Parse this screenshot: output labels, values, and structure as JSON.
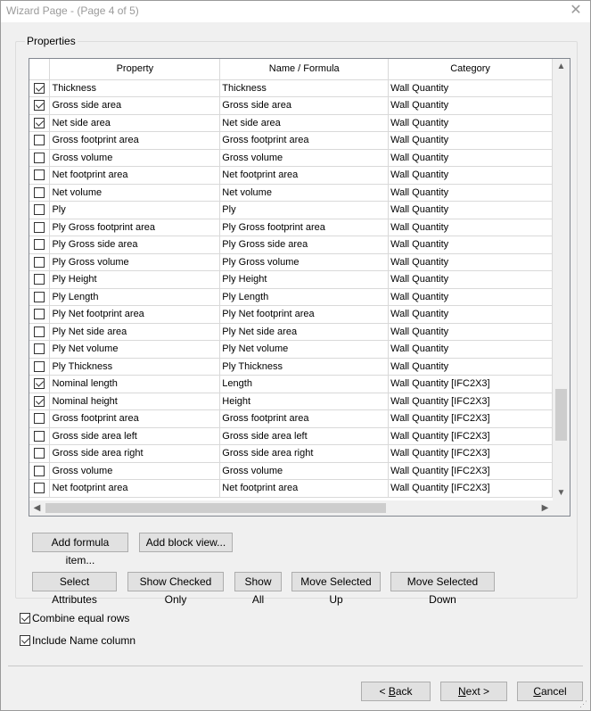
{
  "window": {
    "title": "Wizard Page - (Page 4 of 5)",
    "close_glyph": "✕"
  },
  "group": {
    "legend": "Properties"
  },
  "grid": {
    "columns": [
      "",
      "Property",
      "Name / Formula",
      "Category"
    ],
    "rows": [
      {
        "checked": true,
        "property": "Thickness",
        "name": "Thickness",
        "category": "Wall Quantity"
      },
      {
        "checked": true,
        "property": "Gross side area",
        "name": "Gross side area",
        "category": "Wall Quantity"
      },
      {
        "checked": true,
        "property": "Net side area",
        "name": "Net side area",
        "category": "Wall Quantity"
      },
      {
        "checked": false,
        "property": "Gross footprint area",
        "name": "Gross footprint area",
        "category": "Wall Quantity"
      },
      {
        "checked": false,
        "property": "Gross volume",
        "name": "Gross volume",
        "category": "Wall Quantity"
      },
      {
        "checked": false,
        "property": "Net footprint area",
        "name": "Net footprint area",
        "category": "Wall Quantity"
      },
      {
        "checked": false,
        "property": "Net volume",
        "name": "Net volume",
        "category": "Wall Quantity"
      },
      {
        "checked": false,
        "property": "Ply",
        "name": "Ply",
        "category": "Wall Quantity"
      },
      {
        "checked": false,
        "property": "Ply Gross footprint area",
        "name": "Ply Gross footprint area",
        "category": "Wall Quantity"
      },
      {
        "checked": false,
        "property": "Ply Gross side area",
        "name": "Ply Gross side area",
        "category": "Wall Quantity"
      },
      {
        "checked": false,
        "property": "Ply Gross volume",
        "name": "Ply Gross volume",
        "category": "Wall Quantity"
      },
      {
        "checked": false,
        "property": "Ply Height",
        "name": "Ply Height",
        "category": "Wall Quantity"
      },
      {
        "checked": false,
        "property": "Ply Length",
        "name": "Ply Length",
        "category": "Wall Quantity"
      },
      {
        "checked": false,
        "property": "Ply Net footprint area",
        "name": "Ply Net footprint area",
        "category": "Wall Quantity"
      },
      {
        "checked": false,
        "property": "Ply Net side area",
        "name": "Ply Net side area",
        "category": "Wall Quantity"
      },
      {
        "checked": false,
        "property": "Ply Net volume",
        "name": "Ply Net volume",
        "category": "Wall Quantity"
      },
      {
        "checked": false,
        "property": "Ply Thickness",
        "name": "Ply Thickness",
        "category": "Wall Quantity"
      },
      {
        "checked": true,
        "property": "Nominal length",
        "name": "Length",
        "category": "Wall Quantity [IFC2X3]"
      },
      {
        "checked": true,
        "property": "Nominal height",
        "name": "Height",
        "category": "Wall Quantity [IFC2X3]"
      },
      {
        "checked": false,
        "property": "Gross footprint area",
        "name": "Gross footprint area",
        "category": "Wall Quantity [IFC2X3]"
      },
      {
        "checked": false,
        "property": "Gross side area left",
        "name": "Gross side area left",
        "category": "Wall Quantity [IFC2X3]"
      },
      {
        "checked": false,
        "property": "Gross side area right",
        "name": "Gross side area right",
        "category": "Wall Quantity [IFC2X3]"
      },
      {
        "checked": false,
        "property": "Gross volume",
        "name": "Gross volume",
        "category": "Wall Quantity [IFC2X3]"
      },
      {
        "checked": false,
        "property": "Net footprint area",
        "name": "Net footprint area",
        "category": "Wall Quantity [IFC2X3]"
      }
    ]
  },
  "buttons": {
    "add_formula": "Add formula item...",
    "add_block": "Add block view...",
    "select_attributes": "Select Attributes",
    "show_checked": "Show Checked Only",
    "show_all": "Show All",
    "move_up": "Move Selected Up",
    "move_down": "Move Selected Down"
  },
  "options": {
    "combine_label": "Combine equal rows",
    "combine_checked": true,
    "include_name_label": "Include Name column",
    "include_name_checked": true
  },
  "nav": {
    "back_prefix": "< ",
    "back_key": "B",
    "back_rest": "ack",
    "next_key": "N",
    "next_rest": "ext >",
    "cancel_key": "C",
    "cancel_rest": "ancel"
  }
}
